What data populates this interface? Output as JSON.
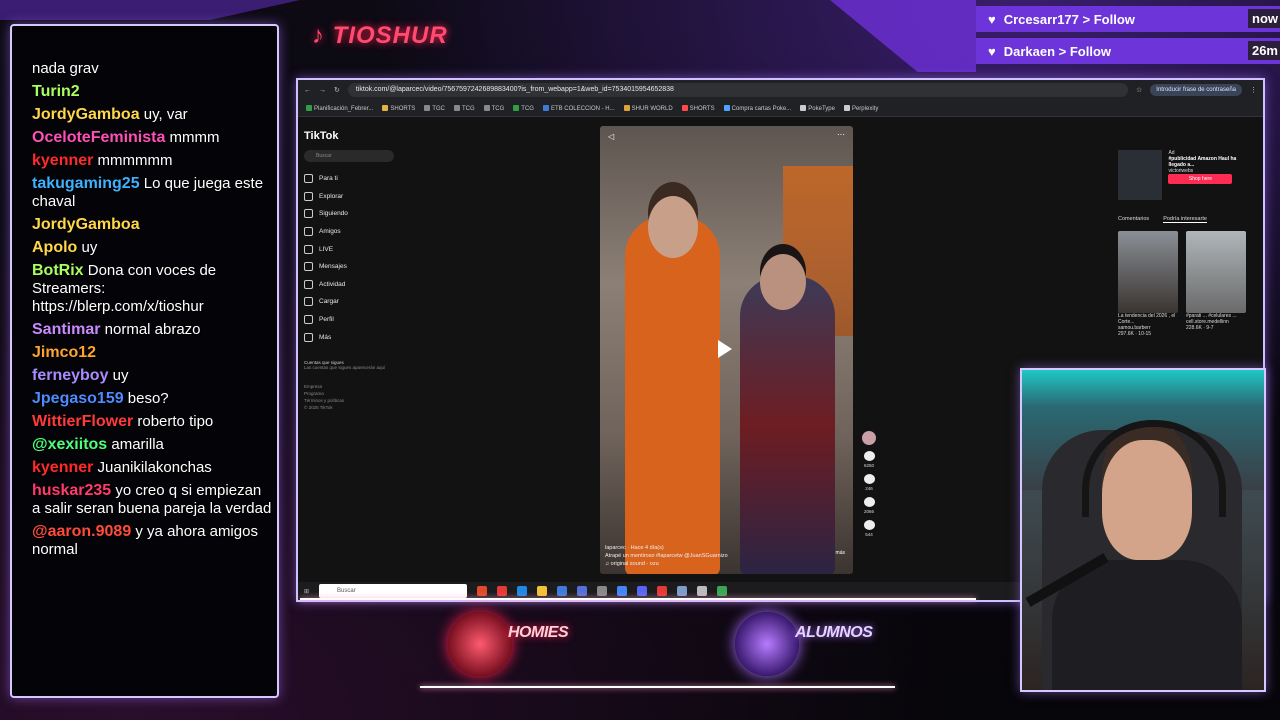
{
  "stream": {
    "logo_text": "TIOSHUR",
    "accent_color": "#7b3ef0",
    "neon_red": "#ff3b5c",
    "neon_purple": "#a96dff"
  },
  "alerts": [
    {
      "user": "Crcesarr177",
      "action": "> Follow",
      "time": "now"
    },
    {
      "user": "Darkaen",
      "action": "> Follow",
      "time": "26m"
    }
  ],
  "chat": [
    {
      "user": "",
      "text": "nada grav",
      "color": "#ffffff"
    },
    {
      "user": "Turin2",
      "text": "",
      "color": "#a9ff5e"
    },
    {
      "user": "JordyGamboa",
      "text": "uy, var",
      "color": "#ffd84a"
    },
    {
      "user": "OceloteFeminista",
      "text": "mmmm",
      "color": "#ff4fb8"
    },
    {
      "user": "kyenner",
      "text": "mmmmmm",
      "color": "#ff2b2b"
    },
    {
      "user": "takugaming25",
      "text": "Lo que juega este chaval",
      "color": "#3db2ff"
    },
    {
      "user": "JordyGamboa",
      "text": "",
      "color": "#ffd84a"
    },
    {
      "user": "Apolo",
      "text": "uy",
      "color": "#ffd84a"
    },
    {
      "user": "BotRix",
      "text": "Dona con voces de Streamers: https://blerp.com/x/tioshur",
      "color": "#a9ff5e"
    },
    {
      "user": "Santimar",
      "text": "normal abrazo",
      "color": "#c98bff"
    },
    {
      "user": "Jimco12",
      "text": "",
      "color": "#ffa52e"
    },
    {
      "user": "ferneyboy",
      "text": "uy",
      "color": "#a98bff"
    },
    {
      "user": "Jpegaso159",
      "text": "beso?",
      "color": "#4d8bff"
    },
    {
      "user": "WittierFlower",
      "text": "roberto tipo",
      "color": "#ff3b3b"
    },
    {
      "user": "@xexiitos",
      "text": "amarilla",
      "color": "#4dff7a"
    },
    {
      "user": "kyenner",
      "text": "Juanikilakonchas",
      "color": "#ff2b2b"
    },
    {
      "user": "huskar235",
      "text": "yo creo q si empiezan a salir seran buena pareja la verdad",
      "color": "#ff3b6e"
    },
    {
      "user": "@aaron.9089",
      "text": "y ya ahora amigos normal",
      "color": "#ff4b3b"
    }
  ],
  "browser": {
    "url": "tiktok.com/@laparcec/video/7567597242689883400?is_from_webapp=1&web_id=7534015954652838",
    "password_prompt": "Introducir frase de contraseña",
    "bookmarks": [
      "Planificación_Febrer...",
      "SHORTS",
      "TGC",
      "TCG",
      "TCG",
      "TCG",
      "ETB COLECCION - H...",
      "SHUR WORLD",
      "SHORTS",
      "Compra cartas Poke...",
      "PokeType",
      "Perplexity"
    ]
  },
  "tiktok": {
    "brand": "TikTok",
    "search_placeholder": "Buscar",
    "nav": [
      "Para ti",
      "Explorar",
      "Siguiendo",
      "Amigos",
      "LIVE",
      "Mensajes",
      "Actividad",
      "Cargar",
      "Perfil",
      "Más"
    ],
    "following_title": "Cuentas que sigues",
    "following_sub": "Las cuentas que sigues aparecerán aquí",
    "footer": [
      "Empresa",
      "Programa",
      "Términos y políticas",
      "© 2025 TikTok"
    ],
    "video": {
      "author": "laparcec · Hace 4 día(s)",
      "caption": "Atrapé un mentiroso #laparcetw @JuanSGuarnizo",
      "more": "más",
      "sound": "♫ original sound - ozu"
    },
    "actions": {
      "likes": "",
      "comments": "246",
      "saves": "2066",
      "shares": "544",
      "first": "6250"
    },
    "ad": {
      "label": "Ad",
      "title": "#publicidad Amazon Haul ha llegado a...",
      "brand": "victoriwebs",
      "button": "Shop here"
    },
    "tabs": [
      "Comentarios",
      "Podría interesarte"
    ],
    "suggested": [
      {
        "title": "La tendencia del 2026 , el Corte...",
        "user": "samou.barberr",
        "views": "297.6K · 10-15"
      },
      {
        "title": "#parati ... #celulares ...",
        "user": "cell.store.medellinn",
        "views": "228.6K · 9-7"
      }
    ]
  },
  "taskbar": {
    "search": "Buscar"
  },
  "overlay": {
    "homies": "HOMIES",
    "alumnos": "ALUMNOS"
  }
}
